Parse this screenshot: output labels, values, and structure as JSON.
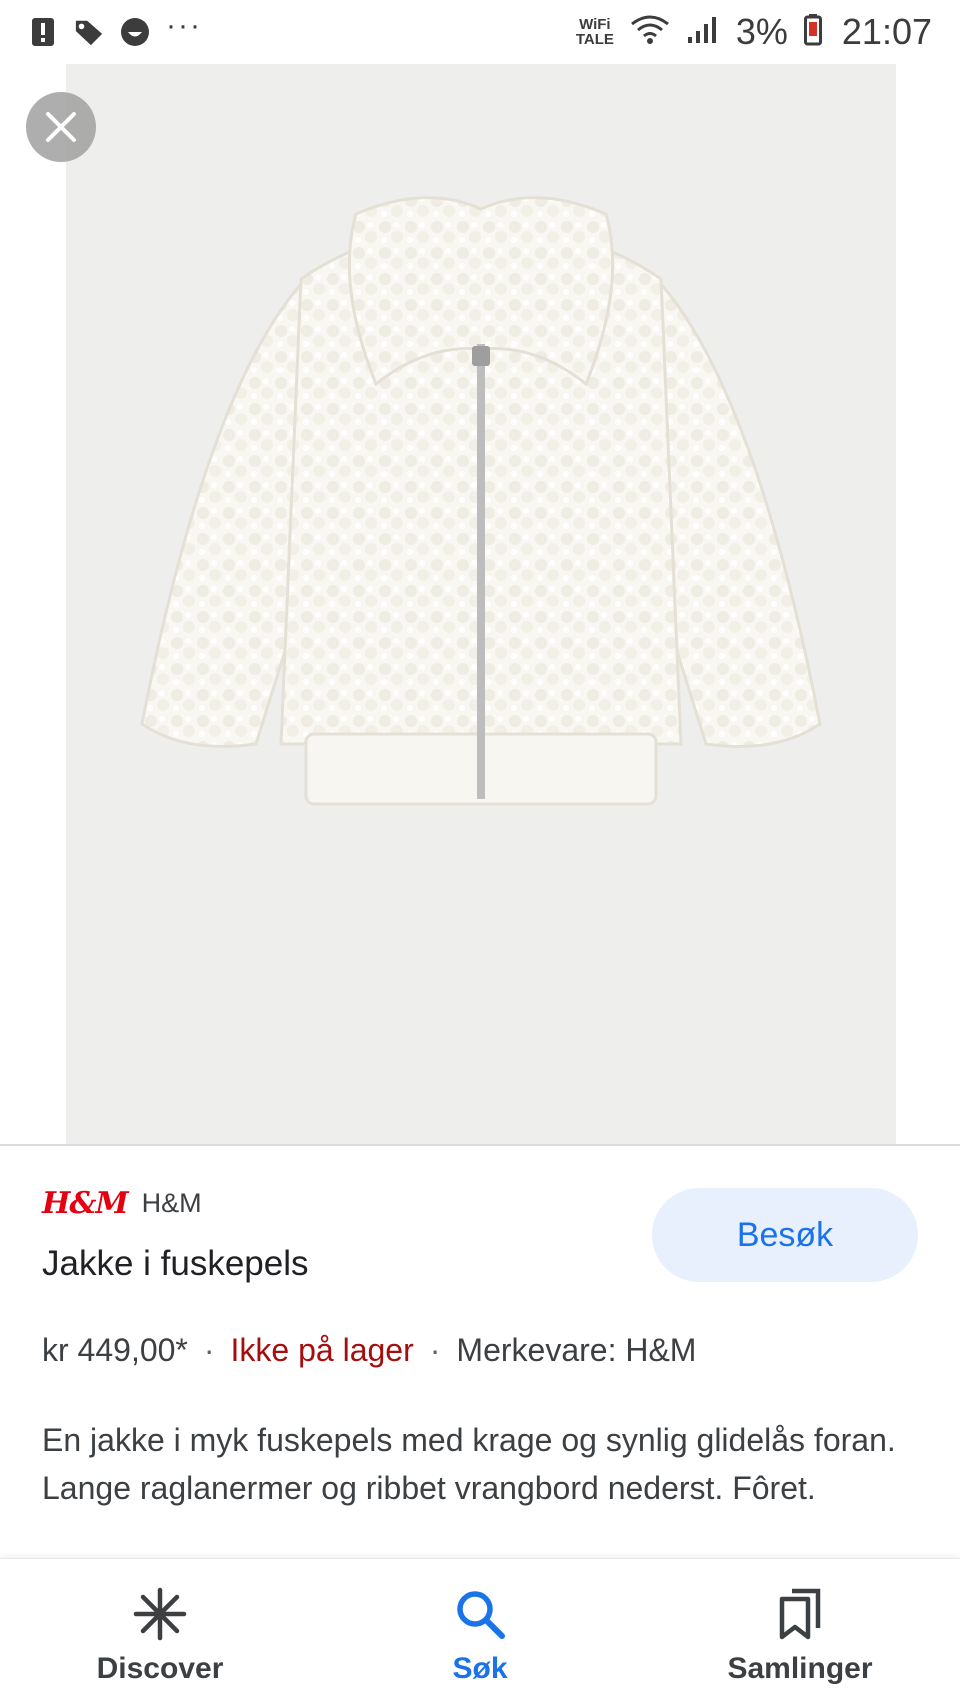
{
  "status_bar": {
    "left_icons": [
      "alert-icon",
      "tag-icon",
      "smiley-icon"
    ],
    "more": "···",
    "wifi_line1": "WiFi",
    "wifi_line2": "TALE",
    "battery": "3%",
    "time": "21:07"
  },
  "product": {
    "brand": "H&M",
    "brand_logo_text": "H&M",
    "title": "Jakke i fuskepels",
    "visit_label": "Besøk",
    "price": "kr 449,00*",
    "separator": "·",
    "stock": "Ikke på lager",
    "brand_meta": "Merkevare: H&M",
    "description": "En jakke i myk fuskepels med krage og synlig glidelås foran. Lange raglanermer og ribbet vrangbord nederst. Fôret."
  },
  "bottom_nav": {
    "items": [
      {
        "label": "Discover",
        "icon": "asterisk-icon",
        "active": false
      },
      {
        "label": "Søk",
        "icon": "search-icon",
        "active": true
      },
      {
        "label": "Samlinger",
        "icon": "collections-icon",
        "active": false
      }
    ]
  },
  "colors": {
    "accent": "#1a73e8",
    "stock_red": "#a50e0e",
    "brand_red": "#e50010",
    "visit_bg": "#e8f0fe"
  }
}
